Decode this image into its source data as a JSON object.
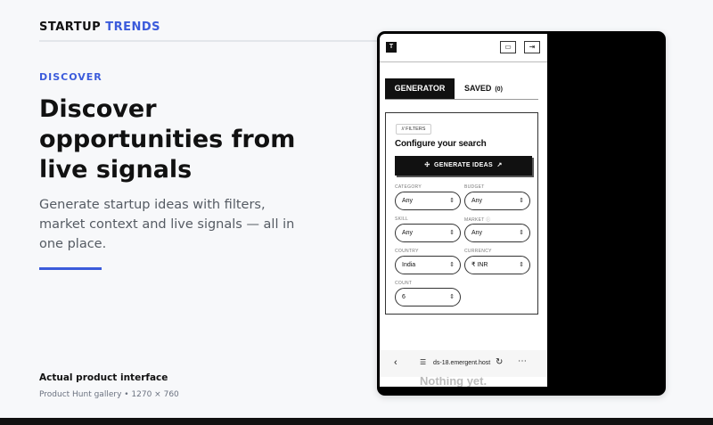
{
  "brand": {
    "primary": "STARTUP",
    "accent": "TRENDS"
  },
  "hero": {
    "eyebrow": "DISCOVER",
    "headline": "Discover opportunities from live signals",
    "subcopy": "Generate startup ideas with filters, market context and live signals — all in one place."
  },
  "caption": {
    "title": "Actual product interface",
    "subtitle": "Product Hunt gallery • 1270 × 760"
  },
  "app": {
    "logo": "T",
    "tabs": {
      "generator": "GENERATOR",
      "saved": "SAVED",
      "saved_count": "(0)"
    },
    "filters_chip": "// FILTERS",
    "panel_title": "Configure your search",
    "generate_button": "GENERATE IDEAS",
    "fields": {
      "category": {
        "label": "CATEGORY",
        "value": "Any"
      },
      "budget": {
        "label": "BUDGET",
        "value": "Any"
      },
      "skill": {
        "label": "SKILL",
        "value": "Any"
      },
      "market": {
        "label": "MARKET ⓘ",
        "value": "Any"
      },
      "country": {
        "label": "COUNTRY",
        "value": "India"
      },
      "currency": {
        "label": "CURRENCY",
        "value": "₹ INR"
      },
      "count": {
        "label": "COUNT",
        "value": "6"
      }
    },
    "empty_state": "Nothing yet.",
    "browser_url": "ds-18.emergent.host"
  },
  "colors": {
    "accent": "#3b5bdb",
    "text": "#111111",
    "muted": "#555b63",
    "background": "#f7f8fa"
  }
}
